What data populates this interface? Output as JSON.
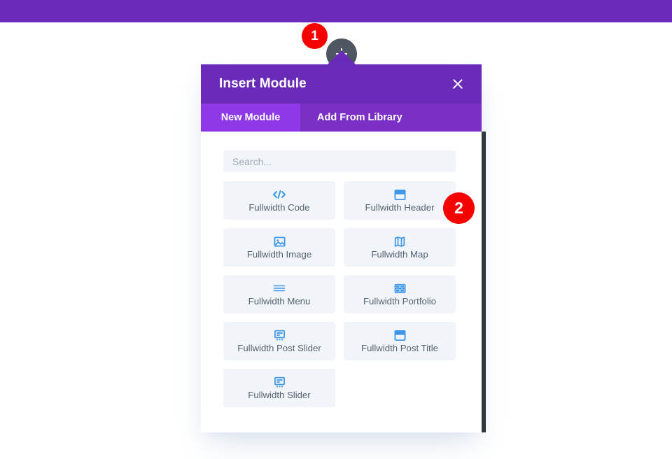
{
  "app": {
    "topbar_color": "#6a2cb8",
    "canvas_background": "#ffffff"
  },
  "add_module_button": {
    "name": "add-module-button",
    "icon": "plus-icon",
    "color": "#4e5661"
  },
  "step_badges": [
    {
      "label": "1",
      "color": "#f60000",
      "target": "add-module-button"
    },
    {
      "label": "2",
      "color": "#f60000",
      "target": "fullwidth-header-tile"
    }
  ],
  "modal": {
    "title": "Insert Module",
    "close_icon": "close-icon",
    "header_color": "#6a2cb8",
    "tabs": [
      {
        "label": "New Module",
        "active": true
      },
      {
        "label": "Add From Library",
        "active": false
      }
    ],
    "search": {
      "placeholder": "Search...",
      "value": ""
    },
    "modules": [
      {
        "label": "Fullwidth Code",
        "icon": "code-icon"
      },
      {
        "label": "Fullwidth Header",
        "icon": "header-icon"
      },
      {
        "label": "Fullwidth Image",
        "icon": "image-icon"
      },
      {
        "label": "Fullwidth Map",
        "icon": "map-icon"
      },
      {
        "label": "Fullwidth Menu",
        "icon": "menu-icon"
      },
      {
        "label": "Fullwidth Portfolio",
        "icon": "portfolio-grid-icon"
      },
      {
        "label": "Fullwidth Post Slider",
        "icon": "post-slider-icon"
      },
      {
        "label": "Fullwidth Post Title",
        "icon": "post-title-icon"
      },
      {
        "label": "Fullwidth Slider",
        "icon": "slider-icon"
      }
    ],
    "accent_icon_color": "#3e97e8",
    "tile_background": "#f1f4f8",
    "scrollbar_color": "#31363b"
  }
}
